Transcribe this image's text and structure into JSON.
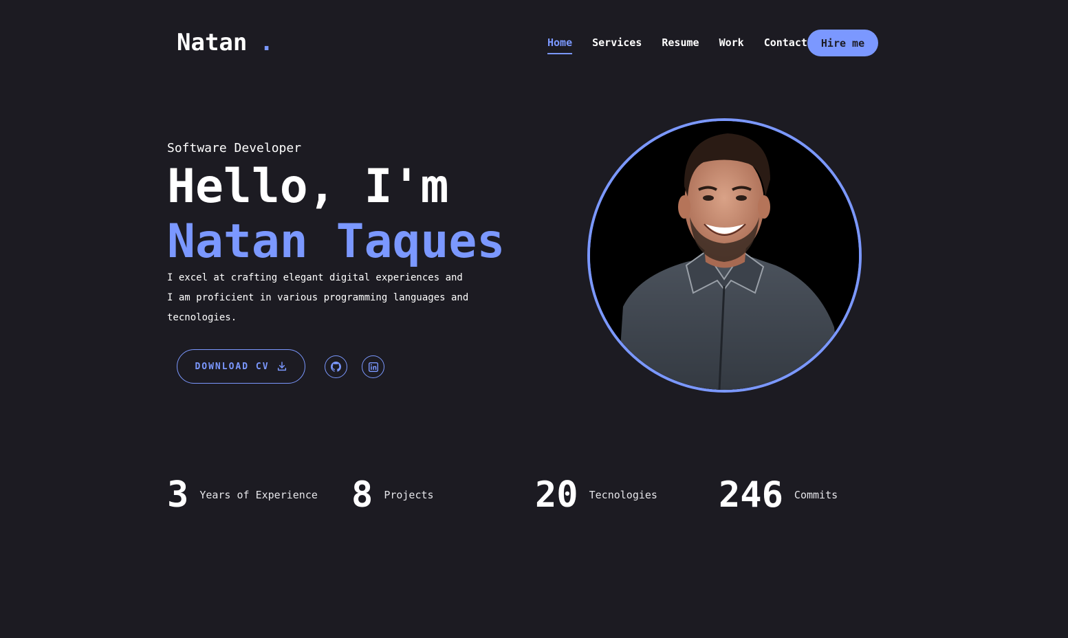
{
  "header": {
    "logo_text": "Natan",
    "logo_dot": ".",
    "nav": [
      {
        "label": "Home",
        "active": true
      },
      {
        "label": "Services",
        "active": false
      },
      {
        "label": "Resume",
        "active": false
      },
      {
        "label": "Work",
        "active": false
      },
      {
        "label": "Contact",
        "active": false
      }
    ],
    "hire_label": "Hire me"
  },
  "hero": {
    "role": "Software Developer",
    "greeting": "Hello, I'm",
    "name": "Natan Taques",
    "bio_lines": [
      "I excel at crafting elegant digital experiences and",
      "I am proficient in various programming languages and",
      "tecnologies."
    ],
    "download_label": "DOWNLOAD CV",
    "social": [
      {
        "icon": "github-icon"
      },
      {
        "icon": "linkedin-icon"
      }
    ]
  },
  "stats": [
    {
      "value": "3",
      "label": "Years of Experience"
    },
    {
      "value": "8",
      "label": "Projects"
    },
    {
      "value": "20",
      "label": "Tecnologies"
    },
    {
      "value": "246",
      "label": "Commits"
    }
  ],
  "colors": {
    "background": "#1c1b22",
    "accent": "#7b98ff",
    "text": "#ffffff"
  }
}
